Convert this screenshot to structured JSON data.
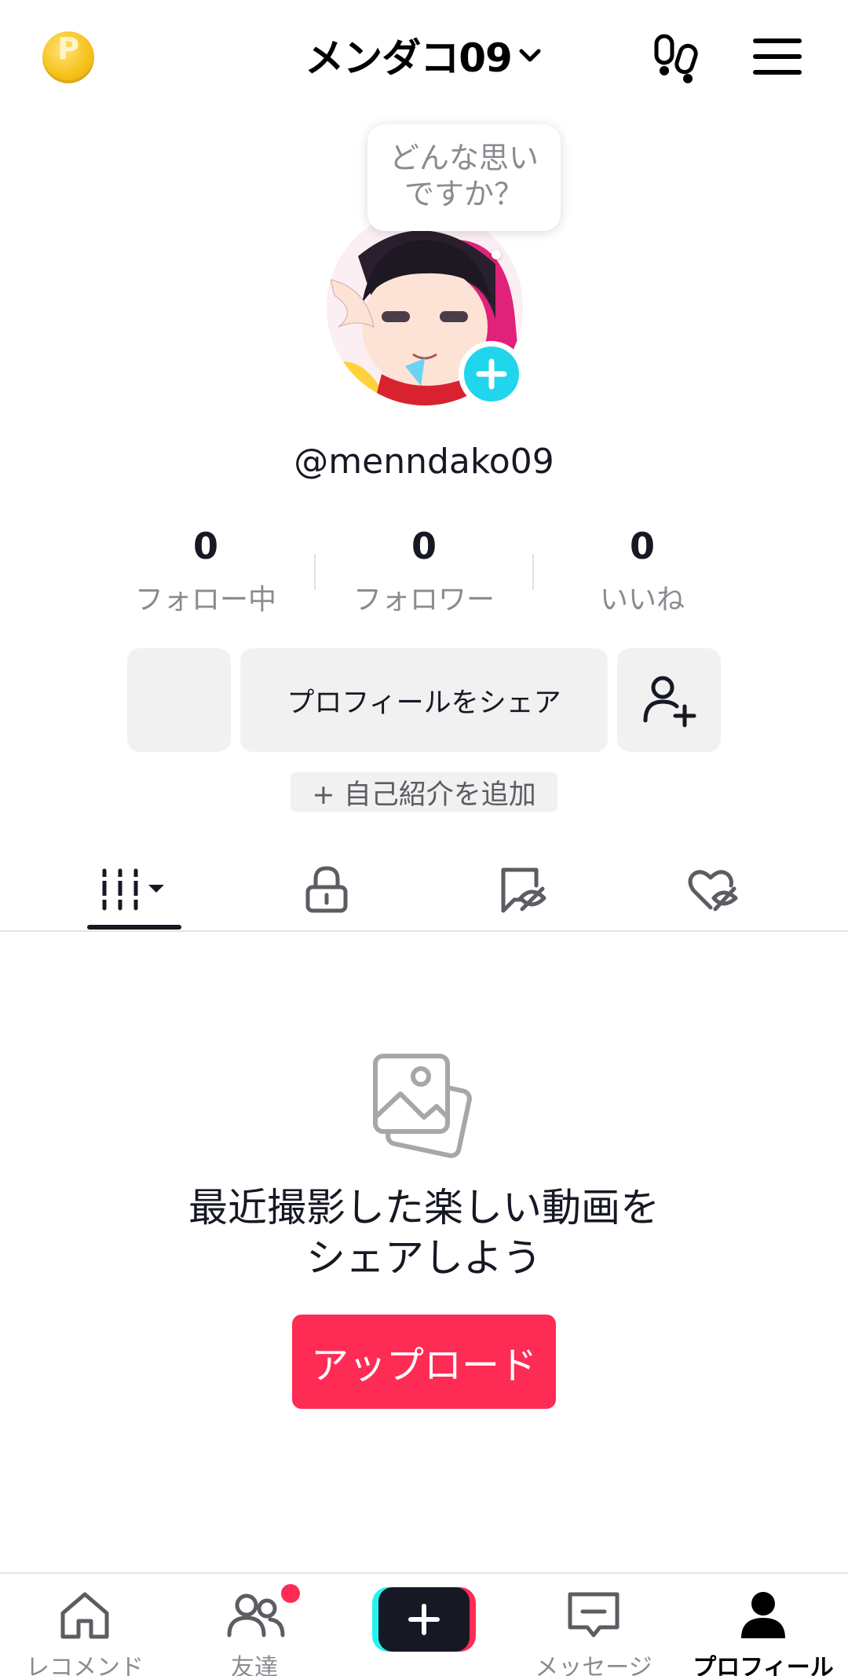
{
  "header": {
    "coin_letter": "P",
    "title": "メンダコ09",
    "icons": [
      "coin-icon",
      "chevron-down-icon",
      "footprints-icon",
      "menu-icon"
    ]
  },
  "profile": {
    "bubble_line1": "どんな思い",
    "bubble_line2": "ですか？",
    "handle": "@menndako09",
    "stats": [
      {
        "value": "0",
        "label": "フォロー中"
      },
      {
        "value": "0",
        "label": "フォロワー"
      },
      {
        "value": "0",
        "label": "いいね"
      }
    ],
    "share_label": "プロフィールをシェア",
    "bio_label": "+ 自己紹介を追加"
  },
  "tabs": {
    "items": [
      "videos-grid-icon",
      "lock-icon",
      "hidden-tag-icon",
      "liked-hidden-icon"
    ],
    "active_index": 0
  },
  "empty_state": {
    "line1": "最近撮影した楽しい動画を",
    "line2": "シェアしよう",
    "upload_label": "アップロード"
  },
  "nav": {
    "items": [
      {
        "label": "レコメンド",
        "icon": "home-icon"
      },
      {
        "label": "友達",
        "icon": "friends-icon"
      },
      {
        "label": "",
        "icon": "create-plus-icon"
      },
      {
        "label": "メッセージ",
        "icon": "message-icon"
      },
      {
        "label": "プロフィール",
        "icon": "profile-icon"
      }
    ],
    "active": "プロフィール"
  },
  "colors": {
    "accent": "#fe2c55",
    "cyan": "#25f4ee",
    "avatar_add": "#20d5ec",
    "text_primary": "#161823",
    "text_secondary": "#8a8b91"
  }
}
